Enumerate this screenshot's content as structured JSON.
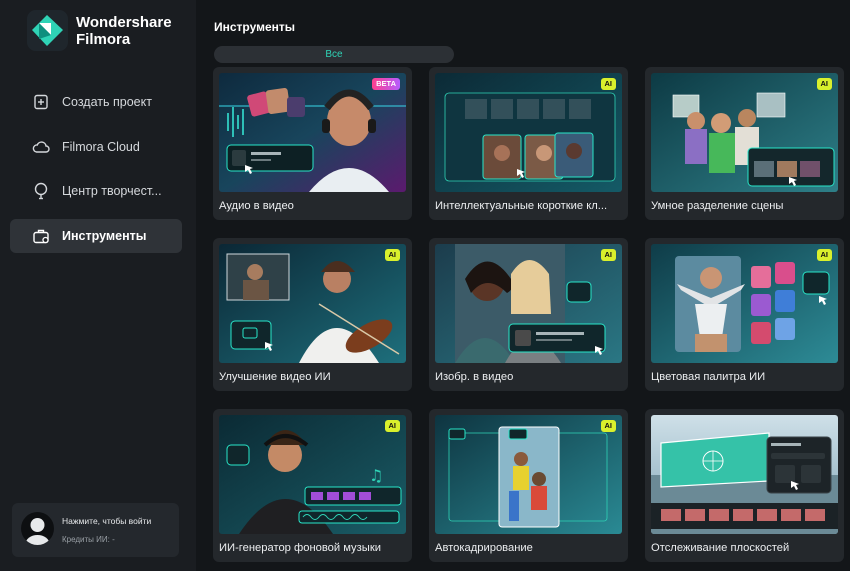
{
  "app": {
    "brand_line1": "Wondershare",
    "brand_line2": "Filmora"
  },
  "sidebar": {
    "items": [
      {
        "label": "Создать проект",
        "icon": "plus-square-icon"
      },
      {
        "label": "Filmora Cloud",
        "icon": "cloud-icon"
      },
      {
        "label": "Центр творчест...",
        "icon": "bulb-icon"
      },
      {
        "label": "Инструменты",
        "icon": "toolbox-icon",
        "active": true
      }
    ]
  },
  "user": {
    "login_text": "Нажмите, чтобы войти",
    "credits_text": "Кредиты ИИ: -"
  },
  "main": {
    "title": "Инструменты",
    "filter_label": "Все",
    "cards": [
      {
        "label": "Аудио в видео",
        "badge": "BETA"
      },
      {
        "label": "Интеллектуальные короткие кл...",
        "badge": "AI"
      },
      {
        "label": "Умное разделение сцены",
        "badge": "AI"
      },
      {
        "label": "Улучшение видео ИИ",
        "badge": "AI"
      },
      {
        "label": "Изобр. в видео",
        "badge": "AI"
      },
      {
        "label": "Цветовая палитра ИИ",
        "badge": "AI"
      },
      {
        "label": "ИИ-генератор фоновой музыки",
        "badge": "AI"
      },
      {
        "label": "Автокадрирование",
        "badge": "AI"
      },
      {
        "label": "Отслеживание плоскостей",
        "badge": ""
      }
    ]
  },
  "colors": {
    "accent": "#2fd3b6",
    "ai_badge": "#d9f02c",
    "sidebar_bg": "#1a1d21",
    "main_bg": "#131619",
    "card_bg": "#24282c"
  }
}
